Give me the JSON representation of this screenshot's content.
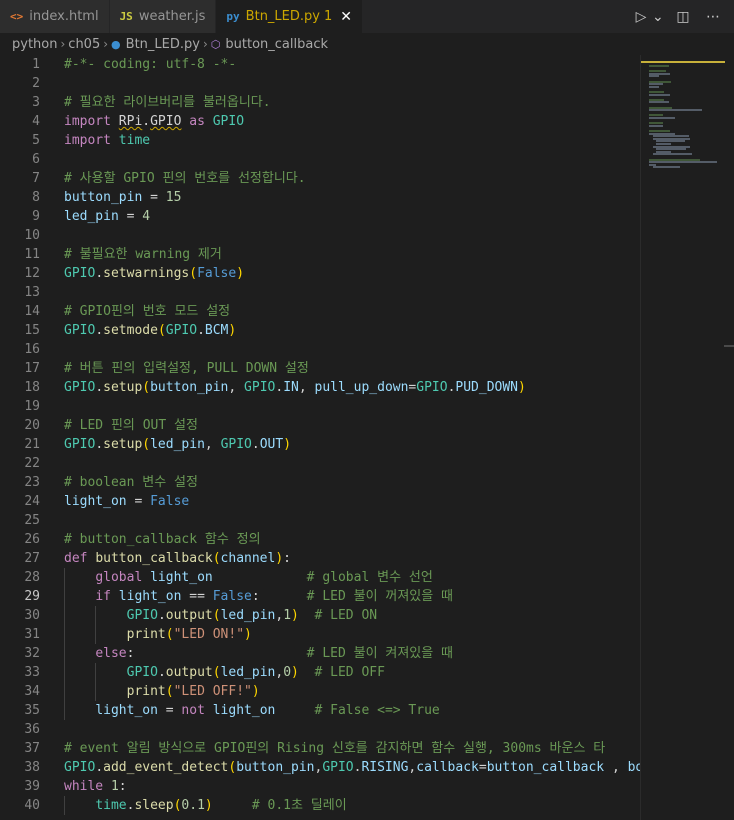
{
  "tabs": [
    {
      "icon": "<>",
      "label": "index.html",
      "active": false
    },
    {
      "icon": "JS",
      "label": "weather.js",
      "active": false
    },
    {
      "icon": "py",
      "label": "Btn_LED.py",
      "number": "1",
      "active": true,
      "close": "✕"
    }
  ],
  "actions": {
    "run": "▷",
    "run_menu": "⌄",
    "split": "◫",
    "more": "⋯"
  },
  "breadcrumb": {
    "folder1": "python",
    "folder2": "ch05",
    "file": "Btn_LED.py",
    "symbol": "button_callback"
  },
  "editor": {
    "current_line": 29,
    "lines": [
      {
        "n": "1",
        "code": "#-*- coding: utf-8 -*-"
      },
      {
        "n": "2",
        "code": ""
      },
      {
        "n": "3",
        "code": "# 필요한 라이브버리를 불러옵니다."
      },
      {
        "n": "4",
        "code": "import RPi.GPIO as GPIO"
      },
      {
        "n": "5",
        "code": "import time"
      },
      {
        "n": "6",
        "code": ""
      },
      {
        "n": "7",
        "code": "# 사용할 GPIO 핀의 번호를 선정합니다."
      },
      {
        "n": "8",
        "code": "button_pin = 15"
      },
      {
        "n": "9",
        "code": "led_pin = 4"
      },
      {
        "n": "10",
        "code": ""
      },
      {
        "n": "11",
        "code": "# 불필요한 warning 제거"
      },
      {
        "n": "12",
        "code": "GPIO.setwarnings(False)"
      },
      {
        "n": "13",
        "code": ""
      },
      {
        "n": "14",
        "code": "# GPIO핀의 번호 모드 설정"
      },
      {
        "n": "15",
        "code": "GPIO.setmode(GPIO.BCM)"
      },
      {
        "n": "16",
        "code": ""
      },
      {
        "n": "17",
        "code": "# 버튼 핀의 입력설정, PULL DOWN 설정"
      },
      {
        "n": "18",
        "code": "GPIO.setup(button_pin, GPIO.IN, pull_up_down=GPIO.PUD_DOWN)"
      },
      {
        "n": "19",
        "code": ""
      },
      {
        "n": "20",
        "code": "# LED 핀의 OUT 설정"
      },
      {
        "n": "21",
        "code": "GPIO.setup(led_pin, GPIO.OUT)"
      },
      {
        "n": "22",
        "code": ""
      },
      {
        "n": "23",
        "code": "# boolean 변수 설정"
      },
      {
        "n": "24",
        "code": "light_on = False"
      },
      {
        "n": "25",
        "code": ""
      },
      {
        "n": "26",
        "code": "# button_callback 함수 정의"
      },
      {
        "n": "27",
        "code": "def button_callback(channel):"
      },
      {
        "n": "28",
        "code": "    global light_on            # global 변수 선언"
      },
      {
        "n": "29",
        "code": "    if light_on == False:      # LED 불이 꺼져있을 때"
      },
      {
        "n": "30",
        "code": "        GPIO.output(led_pin,1)  # LED ON"
      },
      {
        "n": "31",
        "code": "        print(\"LED ON!\")"
      },
      {
        "n": "32",
        "code": "    else:                      # LED 불이 켜져있을 때"
      },
      {
        "n": "33",
        "code": "        GPIO.output(led_pin,0)  # LED OFF"
      },
      {
        "n": "34",
        "code": "        print(\"LED OFF!\")"
      },
      {
        "n": "35",
        "code": "    light_on = not light_on     # False <=> True"
      },
      {
        "n": "36",
        "code": ""
      },
      {
        "n": "37",
        "code": "# event 알림 방식으로 GPIO핀의 Rising 신호를 감지하면 함수 실행, 300ms 바운스 타"
      },
      {
        "n": "38",
        "code": "GPIO.add_event_detect(button_pin,GPIO.RISING,callback=button_callback , bou"
      },
      {
        "n": "39",
        "code": "while 1:"
      },
      {
        "n": "40",
        "code": "    time.sleep(0.1)     # 0.1초 딜레이"
      }
    ]
  },
  "colors": {
    "background": "#1e1e1e",
    "comment": "#6a9955",
    "keyword": "#c586c0",
    "constant": "#569cd6",
    "function": "#dcdcaa",
    "variable": "#9cdcfe",
    "class": "#4ec9b0",
    "number": "#b5cea8",
    "string": "#ce9178"
  }
}
